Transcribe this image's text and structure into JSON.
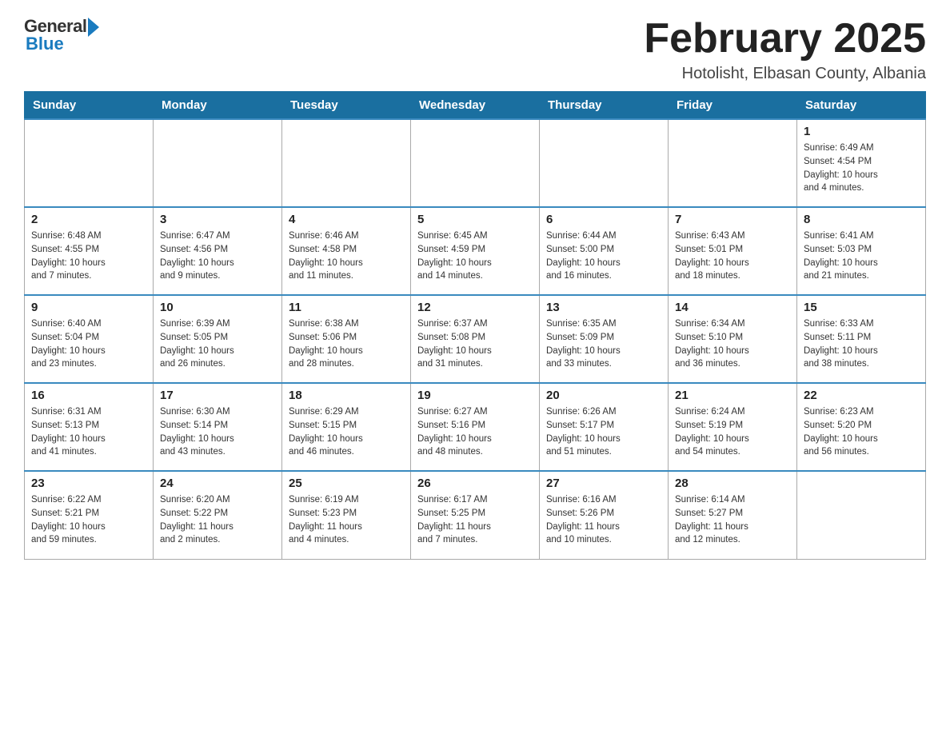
{
  "header": {
    "logo_general": "General",
    "logo_blue": "Blue",
    "month_title": "February 2025",
    "location": "Hotolisht, Elbasan County, Albania"
  },
  "days_of_week": [
    "Sunday",
    "Monday",
    "Tuesday",
    "Wednesday",
    "Thursday",
    "Friday",
    "Saturday"
  ],
  "weeks": [
    [
      {
        "day": "",
        "info": "",
        "empty": true
      },
      {
        "day": "",
        "info": "",
        "empty": true
      },
      {
        "day": "",
        "info": "",
        "empty": true
      },
      {
        "day": "",
        "info": "",
        "empty": true
      },
      {
        "day": "",
        "info": "",
        "empty": true
      },
      {
        "day": "",
        "info": "",
        "empty": true
      },
      {
        "day": "1",
        "info": "Sunrise: 6:49 AM\nSunset: 4:54 PM\nDaylight: 10 hours\nand 4 minutes.",
        "empty": false
      }
    ],
    [
      {
        "day": "2",
        "info": "Sunrise: 6:48 AM\nSunset: 4:55 PM\nDaylight: 10 hours\nand 7 minutes.",
        "empty": false
      },
      {
        "day": "3",
        "info": "Sunrise: 6:47 AM\nSunset: 4:56 PM\nDaylight: 10 hours\nand 9 minutes.",
        "empty": false
      },
      {
        "day": "4",
        "info": "Sunrise: 6:46 AM\nSunset: 4:58 PM\nDaylight: 10 hours\nand 11 minutes.",
        "empty": false
      },
      {
        "day": "5",
        "info": "Sunrise: 6:45 AM\nSunset: 4:59 PM\nDaylight: 10 hours\nand 14 minutes.",
        "empty": false
      },
      {
        "day": "6",
        "info": "Sunrise: 6:44 AM\nSunset: 5:00 PM\nDaylight: 10 hours\nand 16 minutes.",
        "empty": false
      },
      {
        "day": "7",
        "info": "Sunrise: 6:43 AM\nSunset: 5:01 PM\nDaylight: 10 hours\nand 18 minutes.",
        "empty": false
      },
      {
        "day": "8",
        "info": "Sunrise: 6:41 AM\nSunset: 5:03 PM\nDaylight: 10 hours\nand 21 minutes.",
        "empty": false
      }
    ],
    [
      {
        "day": "9",
        "info": "Sunrise: 6:40 AM\nSunset: 5:04 PM\nDaylight: 10 hours\nand 23 minutes.",
        "empty": false
      },
      {
        "day": "10",
        "info": "Sunrise: 6:39 AM\nSunset: 5:05 PM\nDaylight: 10 hours\nand 26 minutes.",
        "empty": false
      },
      {
        "day": "11",
        "info": "Sunrise: 6:38 AM\nSunset: 5:06 PM\nDaylight: 10 hours\nand 28 minutes.",
        "empty": false
      },
      {
        "day": "12",
        "info": "Sunrise: 6:37 AM\nSunset: 5:08 PM\nDaylight: 10 hours\nand 31 minutes.",
        "empty": false
      },
      {
        "day": "13",
        "info": "Sunrise: 6:35 AM\nSunset: 5:09 PM\nDaylight: 10 hours\nand 33 minutes.",
        "empty": false
      },
      {
        "day": "14",
        "info": "Sunrise: 6:34 AM\nSunset: 5:10 PM\nDaylight: 10 hours\nand 36 minutes.",
        "empty": false
      },
      {
        "day": "15",
        "info": "Sunrise: 6:33 AM\nSunset: 5:11 PM\nDaylight: 10 hours\nand 38 minutes.",
        "empty": false
      }
    ],
    [
      {
        "day": "16",
        "info": "Sunrise: 6:31 AM\nSunset: 5:13 PM\nDaylight: 10 hours\nand 41 minutes.",
        "empty": false
      },
      {
        "day": "17",
        "info": "Sunrise: 6:30 AM\nSunset: 5:14 PM\nDaylight: 10 hours\nand 43 minutes.",
        "empty": false
      },
      {
        "day": "18",
        "info": "Sunrise: 6:29 AM\nSunset: 5:15 PM\nDaylight: 10 hours\nand 46 minutes.",
        "empty": false
      },
      {
        "day": "19",
        "info": "Sunrise: 6:27 AM\nSunset: 5:16 PM\nDaylight: 10 hours\nand 48 minutes.",
        "empty": false
      },
      {
        "day": "20",
        "info": "Sunrise: 6:26 AM\nSunset: 5:17 PM\nDaylight: 10 hours\nand 51 minutes.",
        "empty": false
      },
      {
        "day": "21",
        "info": "Sunrise: 6:24 AM\nSunset: 5:19 PM\nDaylight: 10 hours\nand 54 minutes.",
        "empty": false
      },
      {
        "day": "22",
        "info": "Sunrise: 6:23 AM\nSunset: 5:20 PM\nDaylight: 10 hours\nand 56 minutes.",
        "empty": false
      }
    ],
    [
      {
        "day": "23",
        "info": "Sunrise: 6:22 AM\nSunset: 5:21 PM\nDaylight: 10 hours\nand 59 minutes.",
        "empty": false
      },
      {
        "day": "24",
        "info": "Sunrise: 6:20 AM\nSunset: 5:22 PM\nDaylight: 11 hours\nand 2 minutes.",
        "empty": false
      },
      {
        "day": "25",
        "info": "Sunrise: 6:19 AM\nSunset: 5:23 PM\nDaylight: 11 hours\nand 4 minutes.",
        "empty": false
      },
      {
        "day": "26",
        "info": "Sunrise: 6:17 AM\nSunset: 5:25 PM\nDaylight: 11 hours\nand 7 minutes.",
        "empty": false
      },
      {
        "day": "27",
        "info": "Sunrise: 6:16 AM\nSunset: 5:26 PM\nDaylight: 11 hours\nand 10 minutes.",
        "empty": false
      },
      {
        "day": "28",
        "info": "Sunrise: 6:14 AM\nSunset: 5:27 PM\nDaylight: 11 hours\nand 12 minutes.",
        "empty": false
      },
      {
        "day": "",
        "info": "",
        "empty": true
      }
    ]
  ]
}
